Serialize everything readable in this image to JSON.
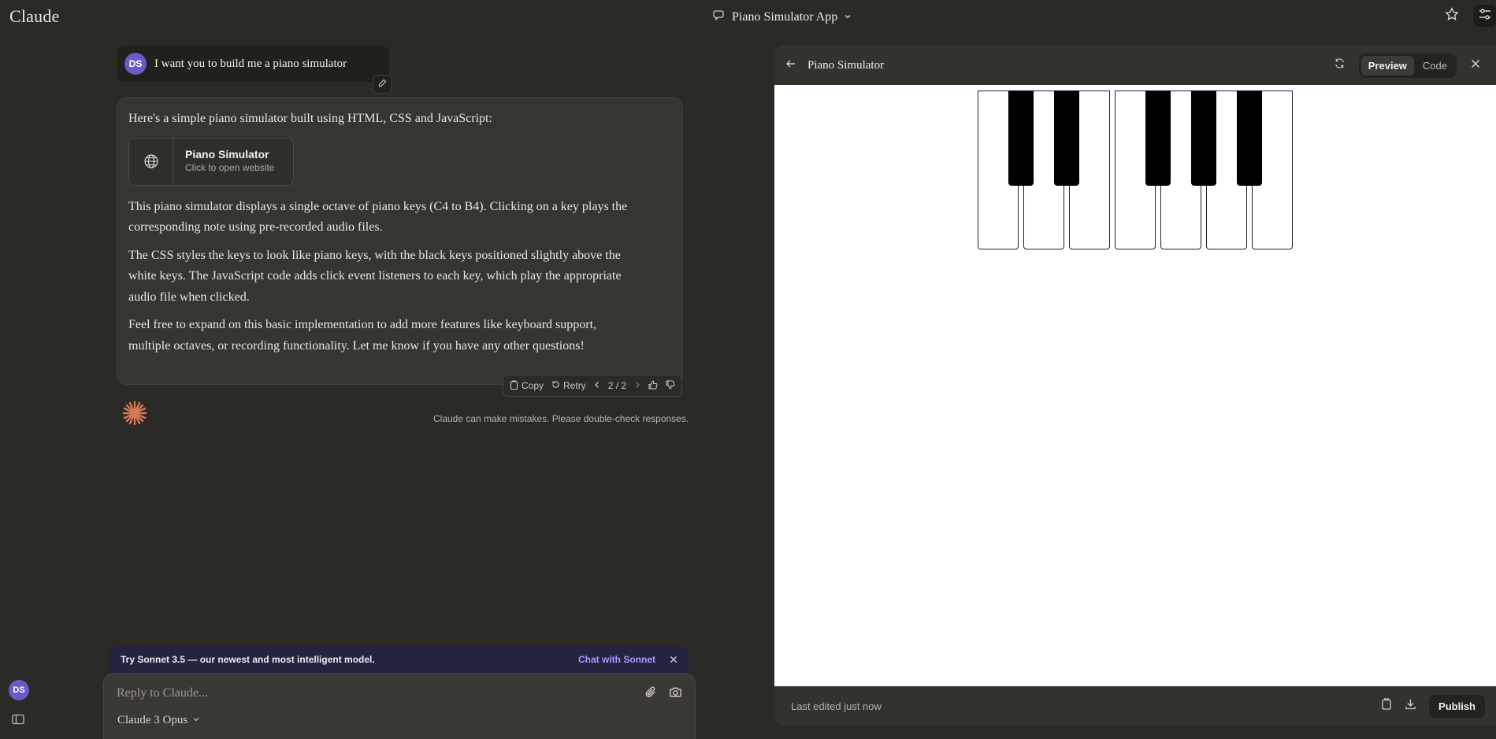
{
  "app": {
    "name": "Claude"
  },
  "header": {
    "conversation_title": "Piano Simulator App"
  },
  "user": {
    "initials": "DS",
    "message": "I want you to build me a piano simulator"
  },
  "assistant": {
    "intro": "Here's a simple piano simulator built using HTML, CSS and JavaScript:",
    "artifact": {
      "name": "Piano Simulator",
      "subtitle": "Click to open website"
    },
    "paragraphs": [
      "This piano simulator displays a single octave of piano keys (C4 to B4). Clicking on a key plays the corresponding note using pre-recorded audio files.",
      "The CSS styles the keys to look like piano keys, with the black keys positioned slightly above the white keys. The JavaScript code adds click event listeners to each key, which play the appropriate audio file when clicked.",
      "Feel free to expand on this basic implementation to add more features like keyboard support, multiple octaves, or recording functionality. Let me know if you have any other questions!"
    ],
    "actions": {
      "copy": "Copy",
      "retry": "Retry",
      "pager": "2 / 2"
    },
    "disclaimer": "Claude can make mistakes. Please double-check responses."
  },
  "promo": {
    "text": "Try Sonnet 3.5 — our newest and most intelligent model.",
    "link": "Chat with Sonnet"
  },
  "composer": {
    "placeholder": "Reply to Claude...",
    "model": "Claude 3 Opus"
  },
  "panel": {
    "title": "Piano Simulator",
    "tabs": {
      "preview": "Preview",
      "code": "Code"
    },
    "active_tab": "Preview",
    "footer_status": "Last edited just now",
    "publish": "Publish",
    "piano": {
      "white_keys": [
        "C4",
        "D4",
        "E4",
        "F4",
        "G4",
        "A4",
        "B4"
      ],
      "black_keys": [
        "C#4",
        "D#4",
        "F#4",
        "G#4",
        "A#4"
      ]
    }
  },
  "colors": {
    "background": "#2b2a27",
    "accent_link": "#a897ff",
    "avatar": "#6d59c4",
    "claude_logo": "#d97757"
  }
}
